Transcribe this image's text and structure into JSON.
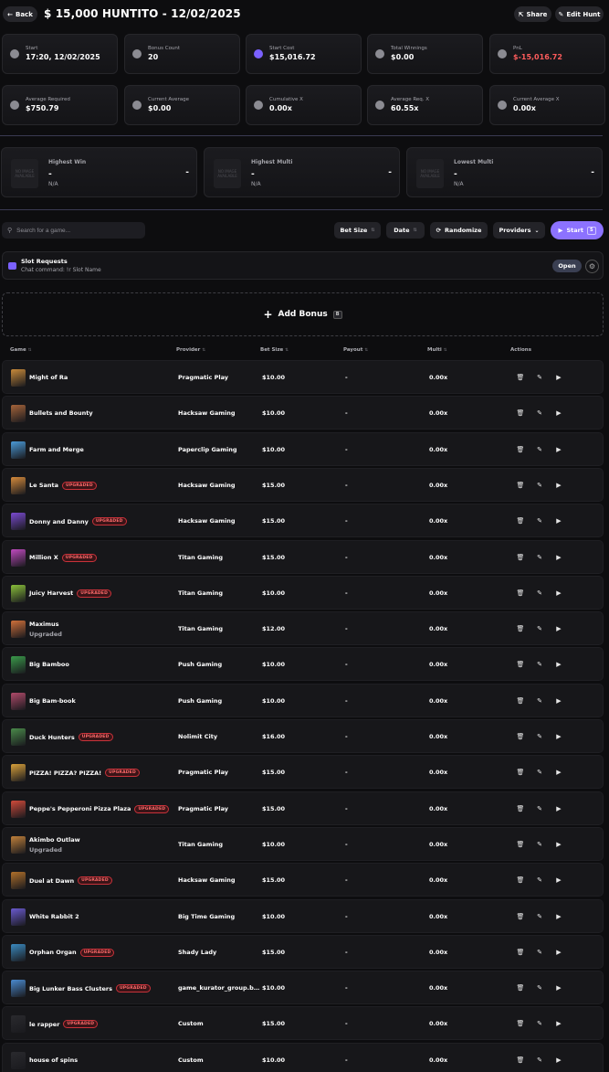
{
  "header": {
    "back_label": "Back",
    "title": "$ 15,000 HUNTITO - 12/02/2025",
    "share_label": "Share",
    "edit_label": "Edit Hunt"
  },
  "stats": [
    {
      "label": "Start",
      "value": "17:20, 12/02/2025",
      "icon": "calendar-icon"
    },
    {
      "label": "Bonus Count",
      "value": "20",
      "icon": "gauge-icon"
    },
    {
      "label": "Start Cost",
      "value": "$15,016.72",
      "icon": "dollar-icon"
    },
    {
      "label": "Total Winnings",
      "value": "$0.00",
      "icon": "hand-coins-icon"
    },
    {
      "label": "PnL",
      "value": "$-15,016.72",
      "icon": "coins-icon"
    },
    {
      "label": "Average Required",
      "value": "$750.79",
      "icon": "target-icon"
    },
    {
      "label": "Current Average",
      "value": "$0.00",
      "icon": "dollar-circle-icon"
    },
    {
      "label": "Cumulative X",
      "value": "0.00x",
      "icon": "hand-coins-icon"
    },
    {
      "label": "Average Req. X",
      "value": "60.55x",
      "icon": "hand-coins-icon"
    },
    {
      "label": "Current Average X",
      "value": "0.00x",
      "icon": "hand-coins-icon"
    }
  ],
  "highlights": [
    {
      "title": "Highest Win",
      "value": "-",
      "sub": "N/A",
      "right": "-",
      "thumb": "NO IMAGE AVAILABLE"
    },
    {
      "title": "Highest Multi",
      "value": "-",
      "sub": "N/A",
      "right": "-",
      "thumb": "NO IMAGE AVAILABLE"
    },
    {
      "title": "Lowest Multi",
      "value": "-",
      "sub": "N/A",
      "right": "-",
      "thumb": "NO IMAGE AVAILABLE"
    }
  ],
  "toolbar": {
    "search_placeholder": "Search for a game...",
    "bet_size_label": "Bet Size",
    "date_label": "Date",
    "randomize_label": "Randomize",
    "providers_label": "Providers",
    "start_label": "Start",
    "start_key": "S"
  },
  "slot_requests": {
    "title": "Slot Requests",
    "command": "Chat command: !r Slot Name",
    "open_label": "Open"
  },
  "add_bonus": {
    "label": "Add Bonus",
    "key": "B"
  },
  "table": {
    "headers": {
      "game": "Game",
      "provider": "Provider",
      "bet_size": "Bet Size",
      "payout": "Payout",
      "multi": "Multi",
      "actions": "Actions"
    },
    "upgraded_badge": "UPGRADED",
    "rows": [
      {
        "game": "Might of Ra",
        "provider": "Pragmatic Play",
        "bet": "$10.00",
        "payout": "-",
        "multi": "0.00x",
        "badge": "",
        "sub": "",
        "color": "#c98a3a"
      },
      {
        "game": "Bullets and Bounty",
        "provider": "Hacksaw Gaming",
        "bet": "$10.00",
        "payout": "-",
        "multi": "0.00x",
        "badge": "",
        "sub": "",
        "color": "#a5643a"
      },
      {
        "game": "Farm and Merge",
        "provider": "Paperclip Gaming",
        "bet": "$10.00",
        "payout": "-",
        "multi": "0.00x",
        "badge": "",
        "sub": "",
        "color": "#4a9ad8"
      },
      {
        "game": "Le Santa",
        "provider": "Hacksaw Gaming",
        "bet": "$15.00",
        "payout": "-",
        "multi": "0.00x",
        "badge": "UPGRADED",
        "sub": "",
        "color": "#d58a3b"
      },
      {
        "game": "Donny and Danny",
        "provider": "Hacksaw Gaming",
        "bet": "$15.00",
        "payout": "-",
        "multi": "0.00x",
        "badge": "UPGRADED",
        "sub": "",
        "color": "#7a4ad0"
      },
      {
        "game": "Million X",
        "provider": "Titan Gaming",
        "bet": "$15.00",
        "payout": "-",
        "multi": "0.00x",
        "badge": "UPGRADED",
        "sub": "",
        "color": "#c04ac0"
      },
      {
        "game": "Juicy Harvest",
        "provider": "Titan Gaming",
        "bet": "$10.00",
        "payout": "-",
        "multi": "0.00x",
        "badge": "UPGRADED",
        "sub": "",
        "color": "#8ac03a"
      },
      {
        "game": "Maximus",
        "provider": "Titan Gaming",
        "bet": "$12.00",
        "payout": "-",
        "multi": "0.00x",
        "badge": "",
        "sub": "Upgraded",
        "color": "#d0703a"
      },
      {
        "game": "Big Bamboo",
        "provider": "Push Gaming",
        "bet": "$10.00",
        "payout": "-",
        "multi": "0.00x",
        "badge": "",
        "sub": "",
        "color": "#3a9a4a"
      },
      {
        "game": "Big Bam-book",
        "provider": "Push Gaming",
        "bet": "$10.00",
        "payout": "-",
        "multi": "0.00x",
        "badge": "",
        "sub": "",
        "color": "#b04a6a"
      },
      {
        "game": "Duck Hunters",
        "provider": "Nolimit City",
        "bet": "$16.00",
        "payout": "-",
        "multi": "0.00x",
        "badge": "UPGRADED",
        "sub": "",
        "color": "#4a8a4a"
      },
      {
        "game": "PIZZA! PIZZA? PIZZA!",
        "provider": "Pragmatic Play",
        "bet": "$15.00",
        "payout": "-",
        "multi": "0.00x",
        "badge": "UPGRADED",
        "sub": "",
        "color": "#d8a03a"
      },
      {
        "game": "Peppe's Pepperoni Pizza Plaza",
        "provider": "Pragmatic Play",
        "bet": "$15.00",
        "payout": "-",
        "multi": "0.00x",
        "badge": "UPGRADED",
        "sub": "",
        "color": "#d04a3a"
      },
      {
        "game": "Akimbo Outlaw",
        "provider": "Titan Gaming",
        "bet": "$10.00",
        "payout": "-",
        "multi": "0.00x",
        "badge": "",
        "sub": "Upgraded",
        "color": "#c0803a"
      },
      {
        "game": "Duel at Dawn",
        "provider": "Hacksaw Gaming",
        "bet": "$15.00",
        "payout": "-",
        "multi": "0.00x",
        "badge": "UPGRADED",
        "sub": "",
        "color": "#b0702a"
      },
      {
        "game": "White Rabbit 2",
        "provider": "Big Time Gaming",
        "bet": "$10.00",
        "payout": "-",
        "multi": "0.00x",
        "badge": "",
        "sub": "",
        "color": "#6a5ad0"
      },
      {
        "game": "Orphan Organ",
        "provider": "Shady Lady",
        "bet": "$15.00",
        "payout": "-",
        "multi": "0.00x",
        "badge": "UPGRADED",
        "sub": "",
        "color": "#3a8ac0"
      },
      {
        "game": "Big Lunker Bass Clusters",
        "provider": "game_kurator_group.blac...",
        "bet": "$10.00",
        "payout": "-",
        "multi": "0.00x",
        "badge": "UPGRADED",
        "sub": "",
        "color": "#4a8ad0"
      },
      {
        "game": "le rapper",
        "provider": "Custom",
        "bet": "$15.00",
        "payout": "-",
        "multi": "0.00x",
        "badge": "UPGRADED",
        "sub": "",
        "color": "#2a2a2e"
      },
      {
        "game": "house of spins",
        "provider": "Custom",
        "bet": "$10.00",
        "payout": "-",
        "multi": "0.00x",
        "badge": "",
        "sub": "",
        "color": "#2a2a2e"
      }
    ]
  },
  "colors": {
    "accent": "#8c72ff",
    "negative": "#ff5c5c",
    "badge_border": "#c9323a"
  }
}
